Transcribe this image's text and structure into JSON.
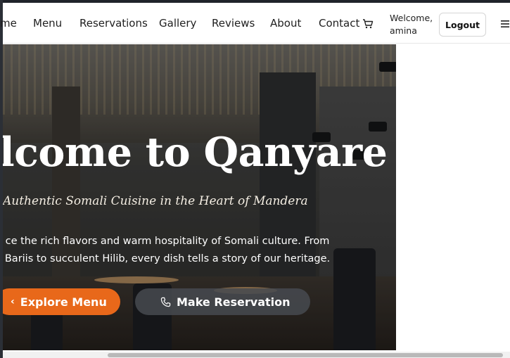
{
  "nav": {
    "items": [
      "me",
      "Menu",
      "Reservations",
      "Gallery",
      "Reviews",
      "About",
      "Contact"
    ],
    "cart_icon": "cart-icon",
    "welcome_line1": "Welcome,",
    "welcome_line2": "amina",
    "logout_label": "Logout",
    "menu_icon": "hamburger-icon"
  },
  "hero": {
    "title": "lcome to Qanyare",
    "subtitle": "Authentic Somali Cuisine in the Heart of Mandera",
    "description_line1": "ce the rich flavors and warm hospitality of Somali culture. From",
    "description_line2": "Bariis to succulent Hilib, every dish tells a story of our heritage.",
    "explore_label": "Explore Menu",
    "reserve_label": "Make Reservation"
  },
  "colors": {
    "accent": "#e8681a",
    "dark_button": "#464a50"
  }
}
